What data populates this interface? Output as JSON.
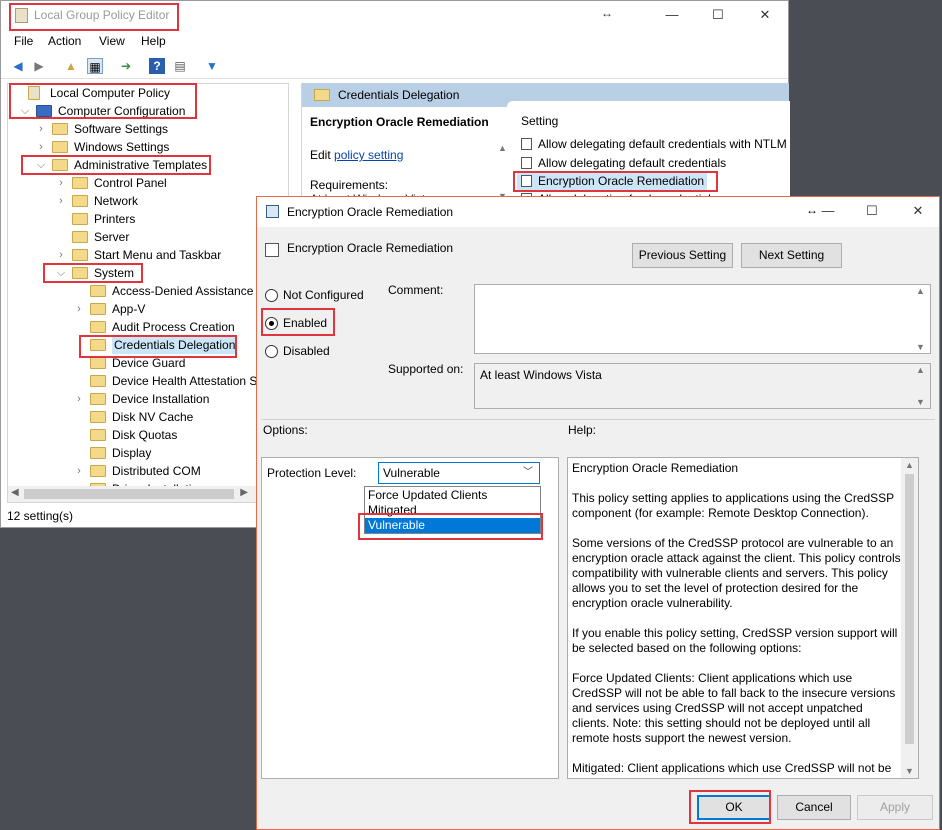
{
  "main_window": {
    "title": "Local Group Policy Editor",
    "resize_glyph": "↔",
    "menu": [
      "File",
      "Action",
      "View",
      "Help"
    ],
    "status": "12 setting(s)",
    "tree": [
      {
        "label": "Local Computer Policy",
        "level": 0,
        "arrow": ""
      },
      {
        "label": "Computer Configuration",
        "level": 1,
        "arrow": "v"
      },
      {
        "label": "Software Settings",
        "level": 2,
        "arrow": ">"
      },
      {
        "label": "Windows Settings",
        "level": 2,
        "arrow": ">"
      },
      {
        "label": "Administrative Templates",
        "level": 2,
        "arrow": "v"
      },
      {
        "label": "Control Panel",
        "level": 3,
        "arrow": ">"
      },
      {
        "label": "Network",
        "level": 3,
        "arrow": ">"
      },
      {
        "label": "Printers",
        "level": 3,
        "arrow": ""
      },
      {
        "label": "Server",
        "level": 3,
        "arrow": ""
      },
      {
        "label": "Start Menu and Taskbar",
        "level": 3,
        "arrow": ">"
      },
      {
        "label": "System",
        "level": 3,
        "arrow": "v"
      },
      {
        "label": "Access-Denied Assistance",
        "level": 4,
        "arrow": ""
      },
      {
        "label": "App-V",
        "level": 4,
        "arrow": ">"
      },
      {
        "label": "Audit Process Creation",
        "level": 4,
        "arrow": ""
      },
      {
        "label": "Credentials Delegation",
        "level": 4,
        "arrow": "",
        "selected": true
      },
      {
        "label": "Device Guard",
        "level": 4,
        "arrow": ""
      },
      {
        "label": "Device Health Attestation Se",
        "level": 4,
        "arrow": ""
      },
      {
        "label": "Device Installation",
        "level": 4,
        "arrow": ">"
      },
      {
        "label": "Disk NV Cache",
        "level": 4,
        "arrow": ""
      },
      {
        "label": "Disk Quotas",
        "level": 4,
        "arrow": ""
      },
      {
        "label": "Display",
        "level": 4,
        "arrow": ""
      },
      {
        "label": "Distributed COM",
        "level": 4,
        "arrow": ">"
      },
      {
        "label": "Driver Installation",
        "level": 4,
        "arrow": ""
      }
    ],
    "right_pane": {
      "header": "Credentials Delegation",
      "ext_title": "Encryption Oracle Remediation",
      "edit_prefix": "Edit",
      "edit_link": "policy setting",
      "requirements_label": "Requirements:",
      "requirements_value": "At least Windows Vista",
      "setting_header": "Setting",
      "settings": [
        "Allow delegating default credentials with NTLM",
        "Allow delegating default credentials",
        "Encryption Oracle Remediation",
        "Allow delegating fresh credentials"
      ]
    }
  },
  "dialog": {
    "title": "Encryption Oracle Remediation",
    "resize_glyph": "↔",
    "policy_name": "Encryption Oracle Remediation",
    "previous_button": "Previous Setting",
    "next_button": "Next Setting",
    "radios": [
      "Not Configured",
      "Enabled",
      "Disabled"
    ],
    "selected_radio": "Enabled",
    "comment_label": "Comment:",
    "comment_value": "",
    "supported_label": "Supported on:",
    "supported_value": "At least Windows Vista",
    "options_label": "Options:",
    "help_label": "Help:",
    "protection_label": "Protection Level:",
    "protection_value": "Vulnerable",
    "protection_options": [
      "Force Updated Clients",
      "Mitigated",
      "Vulnerable"
    ],
    "help_paragraphs": [
      "Encryption Oracle Remediation",
      "This policy setting applies to applications using the CredSSP component (for example: Remote Desktop Connection).",
      "Some versions of the CredSSP protocol are vulnerable to an encryption oracle attack against the client.  This policy controls compatibility with vulnerable clients and servers.  This policy allows you to set the level of protection desired for the encryption oracle vulnerability.",
      "If you enable this policy setting, CredSSP version support will be selected based on the following options:",
      "Force Updated Clients: Client applications which use CredSSP will not be able to fall back to the insecure versions and services using CredSSP will not accept unpatched clients. Note: this setting should not be deployed until all remote hosts support the newest version.",
      "Mitigated: Client applications which use CredSSP will not be able"
    ],
    "ok_button": "OK",
    "cancel_button": "Cancel",
    "apply_button": "Apply"
  },
  "colors": {
    "highlight": "#e0353c",
    "selection": "#0078d7",
    "pane_header": "#b9cfe6",
    "desktop": "#4a4e54"
  }
}
